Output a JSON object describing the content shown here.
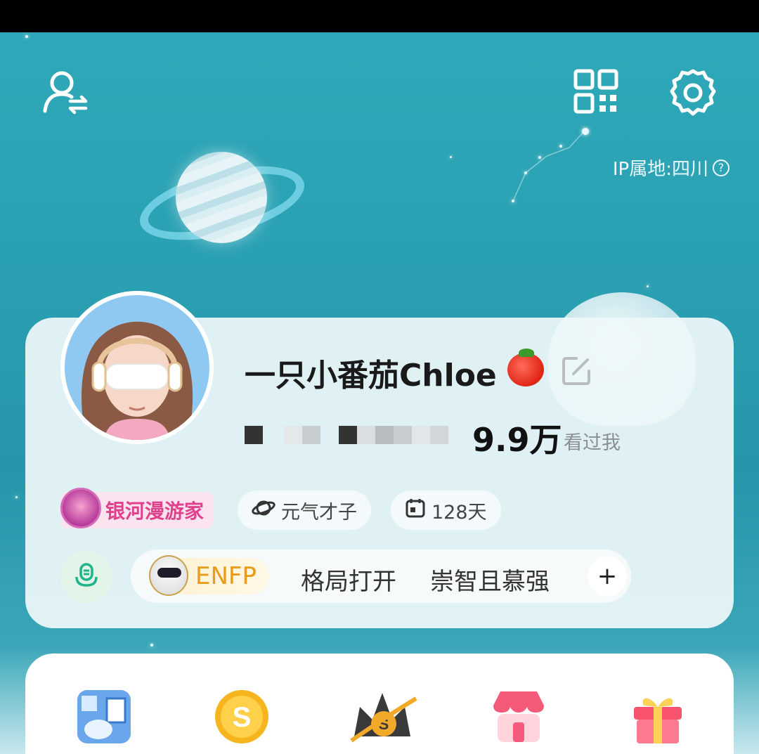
{
  "header": {
    "ip_location": "IP属地:四川",
    "help_glyph": "?"
  },
  "profile": {
    "nickname": "一只小番茄Chloe",
    "views_count": "9.9万",
    "views_label": "看过我"
  },
  "badges": {
    "galaxy_title": "银河漫游家",
    "trait": "元气才子",
    "days": "128天"
  },
  "tags": {
    "mbti": "ENFP",
    "tag1": "格局打开",
    "tag2": "崇智且慕强",
    "add": "+"
  },
  "icons": [
    "switch-account-icon",
    "qr-code-icon",
    "settings-gear-icon",
    "edit-icon",
    "mic-icon",
    "planet-icon",
    "calendar-icon"
  ],
  "services": [
    "mini-program-icon",
    "coin-icon",
    "crown-coin-icon",
    "shop-icon",
    "gift-icon"
  ],
  "colors": {
    "accent_pink": "#e0418c",
    "mbti_orange": "#e99b1b",
    "bg_teal": "#2aa0b2"
  }
}
